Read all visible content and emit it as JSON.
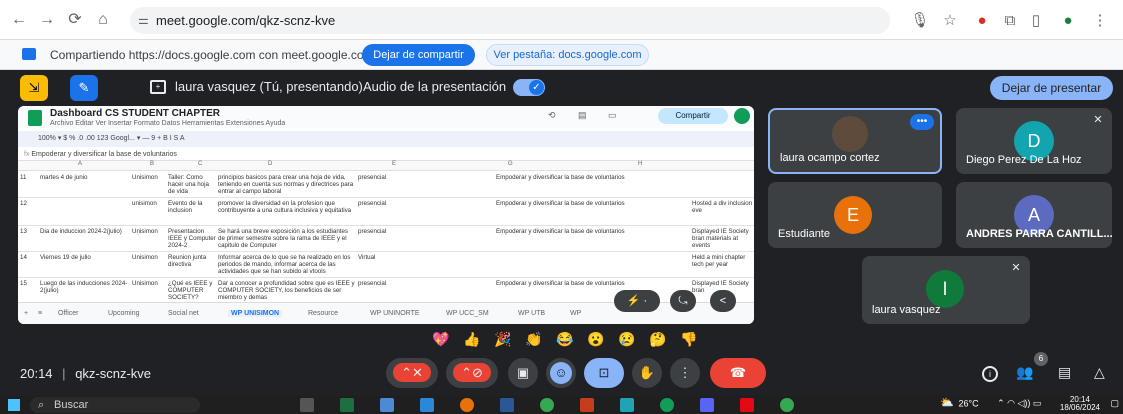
{
  "browser": {
    "url": "meet.google.com/qkz-scnz-kve",
    "icons": [
      "back-icon",
      "forward-icon",
      "reload-icon",
      "home-icon",
      "site-info-icon"
    ]
  },
  "share_bar": {
    "text": "Compartiendo https://docs.google.com con meet.google.com",
    "stop_label": "Dejar de compartir",
    "view_tab_label": "Ver pestaña: docs.google.com"
  },
  "meet_top": {
    "presenter": "laura vasquez (Tú, presentando)",
    "audio_label": "Audio de la presentación",
    "stop_presenting": "Dejar de presentar"
  },
  "sheet": {
    "title": "Dashboard CS STUDENT CHAPTER",
    "menu": "Archivo  Editar  Ver  Insertar  Formato  Datos  Herramientas  Extensiones  Ayuda",
    "share_label": "Compartir",
    "toolbar_text": "100%  ▾  $  %  .0  .00  123  Googl... ▾  —  9  +  B  I  S  A",
    "formula_text": "Empoderar y diversificar la base de voluntarios",
    "rows": [
      {
        "num": "11",
        "date": "martes 4 de junio",
        "mode": "Unisimon",
        "topic": "Taller: Como hacer una hoja de vida",
        "desc": "principios basicos para crear una hoja de vida, teniendo en cuenta sus normas y directrices para entrar al campo laboral",
        "type": "presencial",
        "goal": "Empoderar y diversificar la base de voluntarios",
        "note": ""
      },
      {
        "num": "12",
        "date": "",
        "mode": "unisimon",
        "topic": "Evento de la inclusion",
        "desc": "promover la diversidad en la profesion que contribuyente a una cultura inclusiva y equitativa",
        "type": "presencial",
        "goal": "Empoderar y diversificar la base de voluntarios",
        "note": "Hosted a div inclusion eve"
      },
      {
        "num": "13",
        "date": "Dia de induccion 2024-2(julio)",
        "mode": "Unisimon",
        "topic": "Presentacion IEEE y Computer 2024-2",
        "desc": "Se hará una breve exposición a los estudiantes de primer semestre sobre la rama de IEEE y el capitulo de Computer",
        "type": "presencial",
        "goal": "Empoderar y diversificar la base de voluntarios",
        "note": "Displayed IE Society bran materials at events"
      },
      {
        "num": "14",
        "date": "Viernes 19 de julio",
        "mode": "Unisimon",
        "topic": "Reunion junta directiva",
        "desc": "Informar acerca de lo que se ha realizado en los periodos de mando, informar acerca de las actividades que se han subido al vtools",
        "type": "Virtual",
        "goal": "",
        "note": "Held a mini chapter tech per year"
      },
      {
        "num": "15",
        "date": "Luego de las inducciones 2024-2(julio)",
        "mode": "Unisimon",
        "topic": "¿Qué es IEEE y COMPUTER SOCIETY?",
        "desc": "Dar a conocer a profundidad sobre que es IEEE y COMPUTER SOCIETY, los beneficios de ser miembro y demas",
        "type": "presencial",
        "goal": "Empoderar y diversificar la base de voluntarios",
        "note": "Displayed IE Society bran"
      }
    ],
    "tabs": [
      "Officer",
      "Upcoming",
      "Social net",
      "WP UNISIMON",
      "Resource",
      "WP UNINORTE",
      "WP UCC_SM",
      "WP UTB",
      "WP"
    ]
  },
  "participants": [
    {
      "name": "laura ocampo cortez",
      "initial": "",
      "color": "#5f4b3c"
    },
    {
      "name": "Diego Perez De La Hoz",
      "initial": "D",
      "color": "#12a4af"
    },
    {
      "name": "Estudiante",
      "initial": "E",
      "color": "#e8710a"
    },
    {
      "name": "ANDRES PARRA CANTILL...",
      "initial": "A",
      "color": "#5c6bc0"
    },
    {
      "name": "laura vasquez",
      "initial": "l",
      "color": "#0f7a3a"
    }
  ],
  "reactions": [
    "💖",
    "👍",
    "🎉",
    "👏",
    "😂",
    "😮",
    "😢",
    "🤔",
    "👎"
  ],
  "meeting": {
    "time": "20:14",
    "code": "qkz-scnz-kve",
    "participant_count": "6"
  },
  "taskbar": {
    "search_placeholder": "Buscar",
    "temperature": "26°C",
    "clock_time": "20:14",
    "clock_date": "18/06/2024"
  },
  "colors": {
    "meet_bg": "#202124",
    "accent_blue": "#1a73e8",
    "end_call_red": "#ea4335",
    "active_blue": "#8ab4f8"
  }
}
